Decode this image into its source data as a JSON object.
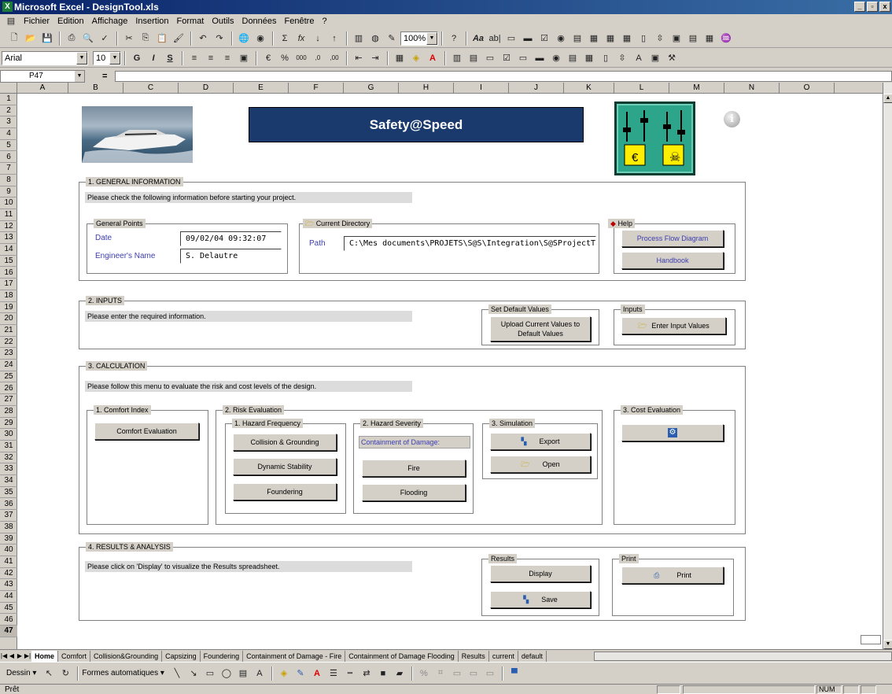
{
  "window": {
    "title": "Microsoft Excel - DesignTool.xls"
  },
  "menu": [
    "Fichier",
    "Edition",
    "Affichage",
    "Insertion",
    "Format",
    "Outils",
    "Données",
    "Fenêtre",
    "?"
  ],
  "toolbar": {
    "zoom": "100%",
    "font": "Arial",
    "font_size": "10"
  },
  "formula": {
    "cell_ref": "P47",
    "eq": "="
  },
  "columns": [
    "A",
    "B",
    "C",
    "D",
    "E",
    "F",
    "G",
    "H",
    "I",
    "J",
    "K",
    "L",
    "M",
    "N",
    "O"
  ],
  "rows": [
    "1",
    "2",
    "3",
    "4",
    "5",
    "6",
    "7",
    "8",
    "9",
    "10",
    "11",
    "12",
    "13",
    "14",
    "15",
    "16",
    "17",
    "18",
    "19",
    "20",
    "21",
    "22",
    "23",
    "24",
    "25",
    "26",
    "27",
    "28",
    "29",
    "30",
    "31",
    "32",
    "33",
    "34",
    "35",
    "36",
    "37",
    "38",
    "39",
    "40",
    "41",
    "42",
    "43",
    "44",
    "45",
    "46",
    "47"
  ],
  "app": {
    "title": "Safety@Speed",
    "logo_symbols": [
      "€",
      "☠"
    ]
  },
  "general": {
    "legend": "1. GENERAL INFORMATION",
    "note": "Please check the following information before starting your project.",
    "points_legend": "General Points",
    "date_label": "Date",
    "date_value": "09/02/04 09:32:07",
    "engineer_label": "Engineer's Name",
    "engineer_value": "S. Delautre",
    "dir_legend": "Current Directory",
    "path_label": "Path",
    "path_value": "C:\\Mes documents\\PROJETS\\S@S\\Integration\\S@SProjectTo",
    "help_legend": "Help",
    "process_btn": "Process Flow Diagram",
    "handbook_btn": "Handbook"
  },
  "inputs": {
    "legend": "2. INPUTS",
    "note": "Please enter the required information.",
    "default_legend": "Set Default Values",
    "upload_btn_1": "Upload Current Values to",
    "upload_btn_2": "Default Values",
    "inputs_legend": "Inputs",
    "enter_btn": "Enter Input Values"
  },
  "calc": {
    "legend": "3. CALCULATION",
    "note": "Please follow this menu to evaluate the risk and cost levels of the design.",
    "comfort_legend": "1. Comfort Index",
    "comfort_btn": "Comfort Evaluation",
    "risk_legend": "2. Risk Evaluation",
    "freq_legend": "1. Hazard Frequency",
    "collision_btn": "Collision & Grounding",
    "stability_btn": "Dynamic Stability",
    "foundering_btn": "Foundering",
    "sev_legend": "2. Hazard Severity",
    "containment_label": "Containment of Damage:",
    "fire_btn": "Fire",
    "flooding_btn": "Flooding",
    "sim_legend": "3. Simulation",
    "export_btn": "Export",
    "open_btn": "Open",
    "cost_legend": "3. Cost Evaluation"
  },
  "results": {
    "legend": "4. RESULTS & ANALYSIS",
    "note": "Please click on 'Display' to visualize the Results spreadsheet.",
    "results_legend": "Results",
    "display_btn": "Display",
    "save_btn": "Save",
    "print_legend": "Print",
    "print_btn": "Print"
  },
  "tabs": [
    "Home",
    "Comfort",
    "Collision&Grounding",
    "Capsizing",
    "Foundering",
    "Containment of Damage - Fire",
    "Containment of Damage Flooding",
    "Results",
    "current",
    "default"
  ],
  "drawbar": {
    "draw": "Dessin",
    "shapes": "Formes automatiques"
  },
  "status": {
    "text": "Prêt",
    "num": "NUM"
  }
}
